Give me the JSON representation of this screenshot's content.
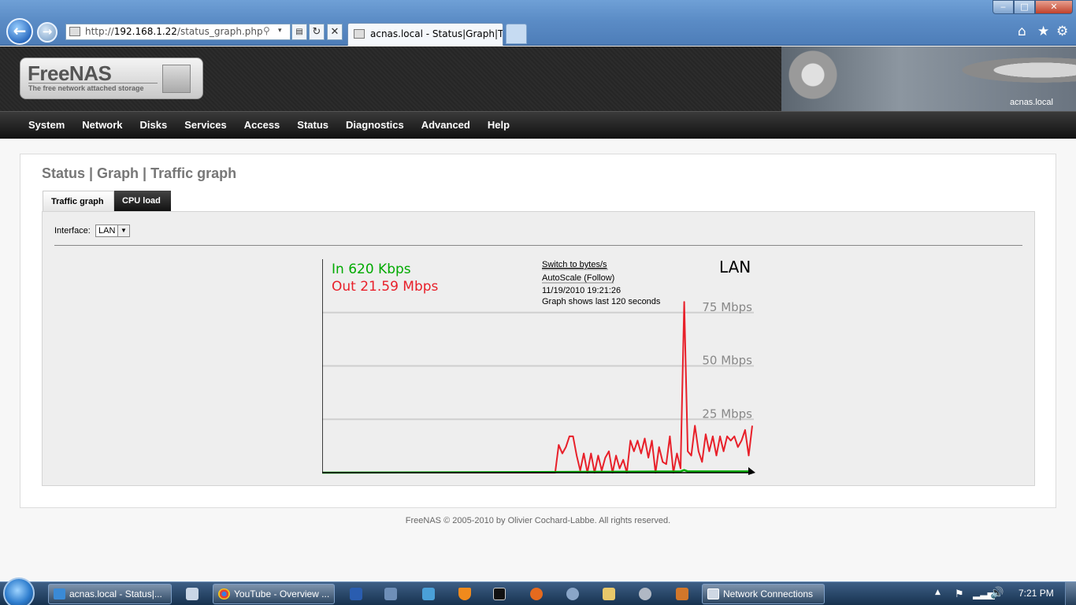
{
  "browser": {
    "url_prefix": "http://",
    "url_host": "192.168.1.22",
    "url_path": "/status_graph.php",
    "tab_title": "acnas.local - Status|Graph|Tra...",
    "back_icon": "back-arrow-icon",
    "forward_icon": "forward-arrow-icon",
    "refresh_glyph": "↻",
    "stop_glyph": "✕",
    "search_glyph": "⚲",
    "dropdown_glyph": "▾",
    "compat_glyph": "▤",
    "home_glyph": "⌂",
    "favorites_glyph": "★",
    "tools_glyph": "⚙",
    "minimize_glyph": "‒",
    "maximize_glyph": "□",
    "close_glyph": "✕"
  },
  "header": {
    "logo_title": "FreeNAS",
    "logo_subtitle": "The free network attached storage",
    "hostname": "acnas.local"
  },
  "nav": {
    "items": [
      "System",
      "Network",
      "Disks",
      "Services",
      "Access",
      "Status",
      "Diagnostics",
      "Advanced",
      "Help"
    ]
  },
  "page": {
    "title": "Status | Graph | Traffic graph",
    "tabs": [
      {
        "label": "Traffic graph",
        "active": true
      },
      {
        "label": "CPU load",
        "active": false
      }
    ],
    "interface_label": "Interface:",
    "interface_value": "LAN",
    "footer": "FreeNAS © 2005-2010 by Olivier Cochard-Labbe. All rights reserved."
  },
  "chart_data": {
    "type": "line",
    "title": "LAN",
    "in_label": "In 620 Kbps",
    "out_label": "Out 21.59 Mbps",
    "switch_link": "Switch to bytes/s",
    "autoscale_link": "AutoScale (Follow)",
    "timestamp": "11/19/2010 19:21:26",
    "window_note": "Graph shows last 120 seconds",
    "y_ticks": [
      {
        "value": 75,
        "label": "75 Mbps"
      },
      {
        "value": 50,
        "label": "50 Mbps"
      },
      {
        "value": 25,
        "label": "25 Mbps"
      }
    ],
    "ylim": [
      0,
      100
    ],
    "xlim": [
      0,
      120
    ],
    "grid": true,
    "colors": {
      "in": "#00aa00",
      "out": "#e8202a",
      "grid": "#cfcfcf",
      "axis": "#000000"
    },
    "series": [
      {
        "name": "Out",
        "x": [
          0,
          65,
          66,
          67,
          68,
          69,
          70,
          71,
          72,
          73,
          74,
          75,
          76,
          77,
          78,
          79,
          80,
          81,
          82,
          83,
          84,
          85,
          86,
          87,
          88,
          89,
          90,
          91,
          92,
          93,
          94,
          95,
          96,
          97,
          98,
          99,
          100,
          101,
          102,
          103,
          104,
          105,
          106,
          107,
          108,
          109,
          110,
          111,
          112,
          113,
          114,
          115,
          116,
          117,
          118,
          119,
          120
        ],
        "y": [
          0,
          0,
          13,
          9,
          12,
          17,
          17,
          8,
          1,
          9,
          0,
          9,
          0,
          8,
          1,
          7,
          10,
          0,
          8,
          2,
          6,
          0,
          15,
          10,
          15,
          9,
          16,
          7,
          15,
          0,
          12,
          5,
          4,
          17,
          0,
          9,
          2,
          80,
          10,
          8,
          22,
          10,
          5,
          18,
          10,
          17,
          8,
          17,
          10,
          17,
          15,
          17,
          12,
          15,
          20,
          8,
          22
        ]
      },
      {
        "name": "In",
        "x": [
          0,
          60,
          80,
          100,
          101,
          102,
          120
        ],
        "y": [
          0,
          0.3,
          0.4,
          0.6,
          1.2,
          0.6,
          0.6
        ]
      }
    ]
  },
  "taskbar": {
    "ie_task": "acnas.local - Status|...",
    "chrome_task": "YouTube - Overview ...",
    "network_task": "Network Connections",
    "clock": "7:21 PM",
    "tray_arrow_glyph": "▲",
    "tray_flag_glyph": "⚑",
    "tray_signal_glyph": "▂▃▅",
    "tray_volume_glyph": "🔊"
  }
}
